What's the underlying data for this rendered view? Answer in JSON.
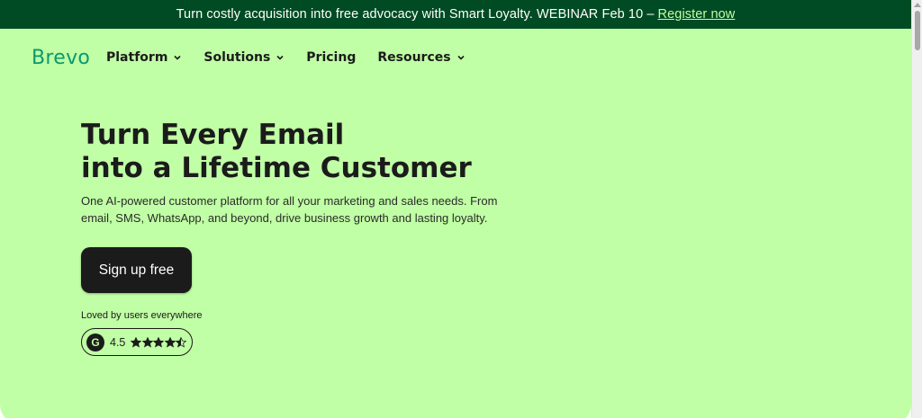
{
  "banner": {
    "text": "Turn costly acquisition into free advocacy with Smart Loyalty. WEBINAR Feb 10 –",
    "link_label": "Register now"
  },
  "header": {
    "logo": "Brevo",
    "nav": [
      {
        "label": "Platform",
        "has_dropdown": true
      },
      {
        "label": "Solutions",
        "has_dropdown": true
      },
      {
        "label": "Pricing",
        "has_dropdown": false
      },
      {
        "label": "Resources",
        "has_dropdown": true
      }
    ]
  },
  "hero": {
    "headline_line1": "Turn Every Email",
    "headline_line2": "into a Lifetime Customer",
    "subtext": "One AI-powered customer platform for all your marketing and sales needs. From email, SMS, WhatsApp, and beyond, drive business growth and lasting loyalty.",
    "cta_label": "Sign up free",
    "loved_text": "Loved by users everywhere",
    "rating_badge_letter": "G",
    "rating_value": "4.5",
    "stars_filled": 4.5,
    "stars_total": 5
  },
  "colors": {
    "banner_bg": "#004b23",
    "hero_bg": "#c0ffa5",
    "brand_green": "#0b996e",
    "dark": "#1b1b1b"
  },
  "icons": {
    "nav_dropdown": "chevron-down-icon",
    "rating_badge": "g2-logo-icon",
    "star": "star-icon"
  }
}
